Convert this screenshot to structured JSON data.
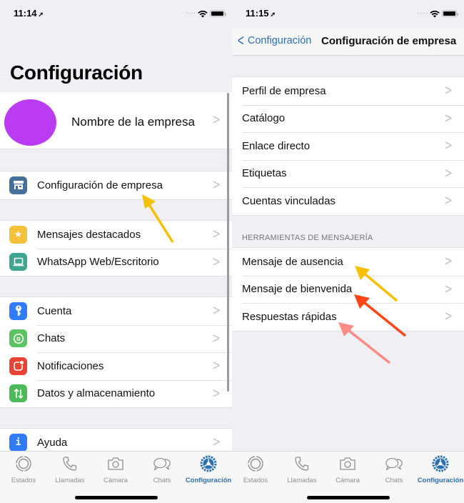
{
  "left_screen": {
    "status": {
      "time": "11:14",
      "location_icon": "location-arrow-icon"
    },
    "title": "Configuración",
    "profile": {
      "name": "Nombre de la empresa",
      "avatar_color": "#bb3bf2"
    },
    "groups": [
      [
        {
          "label": "Configuración de empresa",
          "icon": "store-icon",
          "color": "#46709a"
        }
      ],
      [
        {
          "label": "Mensajes destacados",
          "icon": "star-icon",
          "color": "#f5c13b"
        },
        {
          "label": "WhatsApp Web/Escritorio",
          "icon": "laptop-icon",
          "color": "#3ea591"
        }
      ],
      [
        {
          "label": "Cuenta",
          "icon": "key-icon",
          "color": "#2f7cf6"
        },
        {
          "label": "Chats",
          "icon": "whatsapp-business-icon",
          "color": "#5ac560"
        },
        {
          "label": "Notificaciones",
          "icon": "notification-icon",
          "color": "#ea4335"
        },
        {
          "label": "Datos y almacenamiento",
          "icon": "data-transfer-icon",
          "color": "#4cba5a"
        }
      ],
      [
        {
          "label": "Ayuda",
          "icon": "info-icon",
          "color": "#2f7cf6"
        }
      ]
    ]
  },
  "right_screen": {
    "status": {
      "time": "11:15",
      "location_icon": "location-arrow-icon"
    },
    "nav": {
      "back_label": "Configuración",
      "title": "Configuración de empresa"
    },
    "group1": [
      {
        "label": "Perfil de empresa"
      },
      {
        "label": "Catálogo"
      },
      {
        "label": "Enlace directo"
      },
      {
        "label": "Etiquetas"
      },
      {
        "label": "Cuentas vinculadas"
      }
    ],
    "section_header": "HERRAMIENTAS DE MENSAJERÍA",
    "group2": [
      {
        "label": "Mensaje de ausencia"
      },
      {
        "label": "Mensaje de bienvenida"
      },
      {
        "label": "Respuestas rápidas"
      }
    ]
  },
  "tabbar": {
    "tabs": [
      {
        "label": "Estados",
        "icon": "status-icon",
        "active": false
      },
      {
        "label": "Llamadas",
        "icon": "phone-icon",
        "active": false
      },
      {
        "label": "Cámara",
        "icon": "camera-icon",
        "active": false
      },
      {
        "label": "Chats",
        "icon": "chats-icon",
        "active": false
      },
      {
        "label": "Configuración",
        "icon": "settings-gear-icon",
        "active": true
      }
    ]
  },
  "annotations": {
    "arrow_colors": {
      "yellow": "#f5c000",
      "red": "#ff4517",
      "pink": "#ff8a86"
    }
  },
  "colors": {
    "accent": "#2a6fb0",
    "background": "#efeff4",
    "chevron": "#c4c4c8"
  }
}
